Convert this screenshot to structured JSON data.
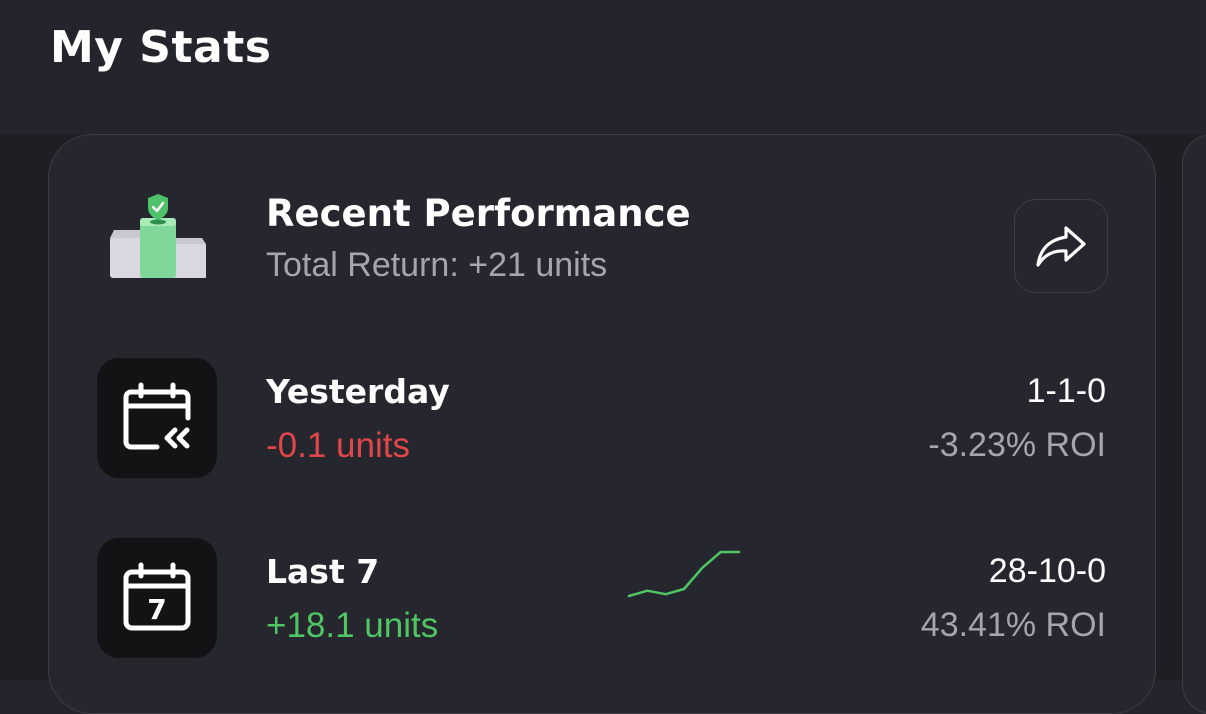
{
  "header": {
    "title": "My Stats"
  },
  "colors": {
    "background": "#23242c",
    "card": "#25262e",
    "positive": "#4fc563",
    "negative": "#e0474a",
    "muted": "#a5a6ad"
  },
  "performance_card": {
    "icon": "podium-shield-icon",
    "title": "Recent Performance",
    "subtitle": "Total Return: +21 units",
    "share_icon": "share-arrow-icon",
    "rows": [
      {
        "icon": "calendar-back-icon",
        "label": "Yesterday",
        "units": "-0.1 units",
        "record": "1-1-0",
        "roi": "-3.23% ROI"
      },
      {
        "icon": "calendar-7-icon",
        "icon_text": "7",
        "label": "Last 7",
        "units": "+18.1 units",
        "record": "28-10-0",
        "roi": "43.41% ROI",
        "trend": [
          0,
          3,
          1,
          4,
          16,
          25,
          25
        ]
      }
    ]
  }
}
